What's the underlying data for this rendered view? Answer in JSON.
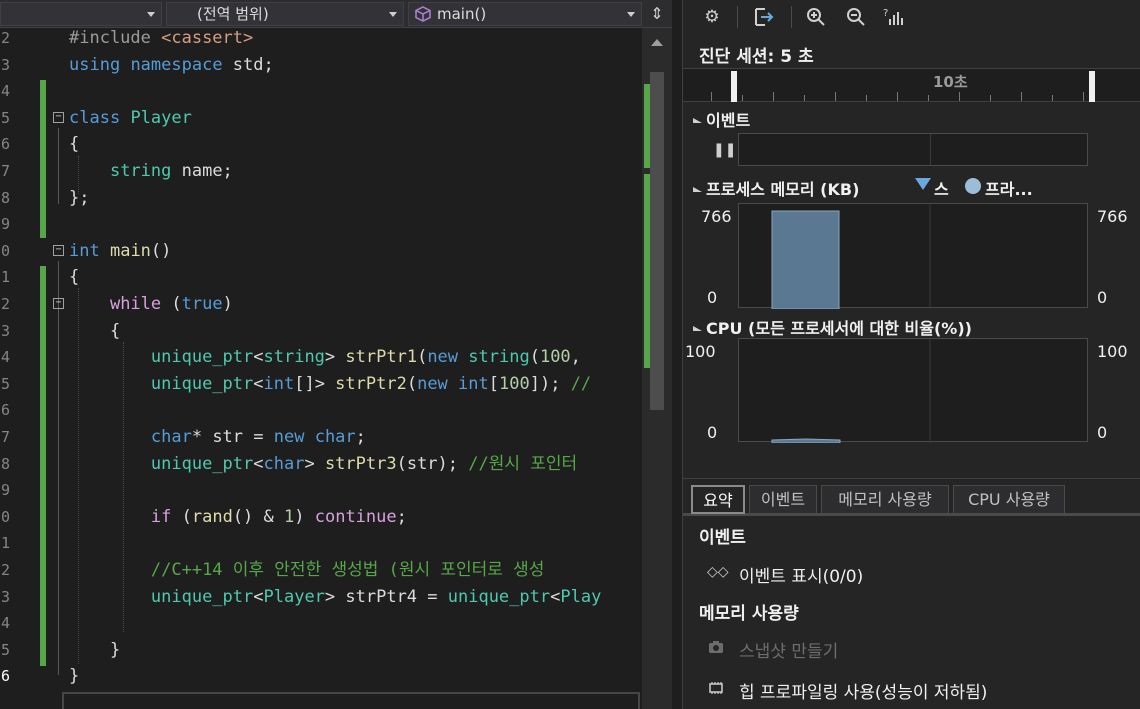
{
  "nav": {
    "scope_dropdown": "(전역 범위)",
    "member_dropdown": "main()",
    "split_glyph": "⇕"
  },
  "code_lines": [
    {
      "num": "2",
      "tokens": [
        [
          "pp",
          "#include "
        ],
        [
          "st",
          "<cassert>"
        ]
      ]
    },
    {
      "num": "3",
      "tokens": [
        [
          "kw",
          "using"
        ],
        [
          "pl",
          " "
        ],
        [
          "kw",
          "namespace"
        ],
        [
          "pl",
          " std;"
        ]
      ]
    },
    {
      "num": "4",
      "tokens": []
    },
    {
      "num": "5",
      "tokens": [
        [
          "kw",
          "class"
        ],
        [
          "pl",
          " "
        ],
        [
          "ty",
          "Player"
        ]
      ]
    },
    {
      "num": "6",
      "tokens": [
        [
          "pl",
          "{"
        ]
      ]
    },
    {
      "num": "7",
      "tokens": [
        [
          "pl",
          "    "
        ],
        [
          "ty",
          "string"
        ],
        [
          "pl",
          " name;"
        ]
      ]
    },
    {
      "num": "8",
      "tokens": [
        [
          "pl",
          "};"
        ]
      ]
    },
    {
      "num": "9",
      "tokens": []
    },
    {
      "num": "0",
      "tokens": [
        [
          "kw",
          "int"
        ],
        [
          "pl",
          " "
        ],
        [
          "fn",
          "main"
        ],
        [
          "pl",
          "()"
        ]
      ]
    },
    {
      "num": "1",
      "tokens": [
        [
          "pl",
          "{"
        ]
      ]
    },
    {
      "num": "2",
      "tokens": [
        [
          "pl",
          "    "
        ],
        [
          "pu",
          "while"
        ],
        [
          "pl",
          " ("
        ],
        [
          "kw",
          "true"
        ],
        [
          "pl",
          ")"
        ]
      ]
    },
    {
      "num": "3",
      "tokens": [
        [
          "pl",
          "    {"
        ]
      ]
    },
    {
      "num": "4",
      "tokens": [
        [
          "pl",
          "        "
        ],
        [
          "ty",
          "unique_ptr"
        ],
        [
          "pl",
          "<"
        ],
        [
          "ty",
          "string"
        ],
        [
          "pl",
          "> "
        ],
        [
          "fn",
          "strPtr1"
        ],
        [
          "pl",
          "("
        ],
        [
          "kw",
          "new"
        ],
        [
          "pl",
          " "
        ],
        [
          "ty",
          "string"
        ],
        [
          "pl",
          "("
        ],
        [
          "nu",
          "100"
        ],
        [
          "pl",
          ", "
        ]
      ]
    },
    {
      "num": "5",
      "tokens": [
        [
          "pl",
          "        "
        ],
        [
          "ty",
          "unique_ptr"
        ],
        [
          "pl",
          "<"
        ],
        [
          "kw",
          "int"
        ],
        [
          "pl",
          "[]> "
        ],
        [
          "fn",
          "strPtr2"
        ],
        [
          "pl",
          "("
        ],
        [
          "kw",
          "new"
        ],
        [
          "pl",
          " "
        ],
        [
          "kw",
          "int"
        ],
        [
          "pl",
          "["
        ],
        [
          "nu",
          "100"
        ],
        [
          "pl",
          "]); "
        ],
        [
          "cm",
          "//"
        ]
      ]
    },
    {
      "num": "6",
      "tokens": []
    },
    {
      "num": "7",
      "tokens": [
        [
          "pl",
          "        "
        ],
        [
          "kw",
          "char"
        ],
        [
          "pl",
          "* str = "
        ],
        [
          "kw",
          "new"
        ],
        [
          "pl",
          " "
        ],
        [
          "kw",
          "char"
        ],
        [
          "pl",
          ";"
        ]
      ]
    },
    {
      "num": "8",
      "tokens": [
        [
          "pl",
          "        "
        ],
        [
          "ty",
          "unique_ptr"
        ],
        [
          "pl",
          "<"
        ],
        [
          "kw",
          "char"
        ],
        [
          "pl",
          "> "
        ],
        [
          "fn",
          "strPtr3"
        ],
        [
          "pl",
          "(str); "
        ],
        [
          "cm",
          "//원시 포인터"
        ]
      ]
    },
    {
      "num": "9",
      "tokens": []
    },
    {
      "num": "0",
      "tokens": [
        [
          "pl",
          "        "
        ],
        [
          "pu",
          "if"
        ],
        [
          "pl",
          " ("
        ],
        [
          "fn",
          "rand"
        ],
        [
          "pl",
          "() & "
        ],
        [
          "nu",
          "1"
        ],
        [
          "pl",
          ") "
        ],
        [
          "pu",
          "continue"
        ],
        [
          "pl",
          ";"
        ]
      ]
    },
    {
      "num": "1",
      "tokens": []
    },
    {
      "num": "2",
      "tokens": [
        [
          "pl",
          "        "
        ],
        [
          "cm",
          "//C++14 이후 안전한 생성법 (원시 포인터로 생성"
        ]
      ]
    },
    {
      "num": "3",
      "tokens": [
        [
          "pl",
          "        "
        ],
        [
          "ty",
          "unique_ptr"
        ],
        [
          "pl",
          "<"
        ],
        [
          "ty",
          "Player"
        ],
        [
          "pl",
          "> strPtr4 = "
        ],
        [
          "ty",
          "unique_ptr"
        ],
        [
          "pl",
          "<"
        ],
        [
          "ty",
          "Play"
        ]
      ]
    },
    {
      "num": "4",
      "tokens": []
    },
    {
      "num": "5",
      "tokens": [
        [
          "pl",
          "    }"
        ]
      ]
    },
    {
      "num": "6",
      "tokens": [
        [
          "pl",
          "}"
        ]
      ]
    }
  ],
  "diag": {
    "session_label": "진단 세션: 5 초",
    "ruler_label": "10초",
    "events_header": "이벤트",
    "memory_header": "프로세스 메모리 (KB)",
    "memory_legend": [
      "스",
      "프라..."
    ],
    "memory_max": "766",
    "memory_min": "0",
    "cpu_header": "CPU (모든 프로세서에 대한 비율(%))",
    "cpu_max": "100",
    "cpu_min": "0",
    "tabs": [
      "요약",
      "이벤트",
      "메모리 사용량",
      "CPU 사용량"
    ],
    "summary": {
      "events_title": "이벤트",
      "show_events": "이벤트 표시(0/0)",
      "memory_title": "메모리 사용량",
      "snapshot": "스냅샷 만들기",
      "heap_profiling": "힙 프로파일링 사용(성능이 저하됨)"
    }
  },
  "chart_data": [
    {
      "type": "area",
      "title": "프로세스 메모리 (KB)",
      "ylim": [
        0,
        766
      ],
      "series": [
        {
          "name": "프라...",
          "x": [
            0.5,
            1.5
          ],
          "values": [
            766,
            766
          ]
        }
      ]
    },
    {
      "type": "area",
      "title": "CPU (모든 프로세서에 대한 비율(%))",
      "ylim": [
        0,
        100
      ],
      "series": [
        {
          "values": [
            3,
            4,
            3
          ]
        }
      ]
    }
  ],
  "colors": {
    "accent_green": "#57a64a",
    "chart_fill": "#5a7891"
  }
}
